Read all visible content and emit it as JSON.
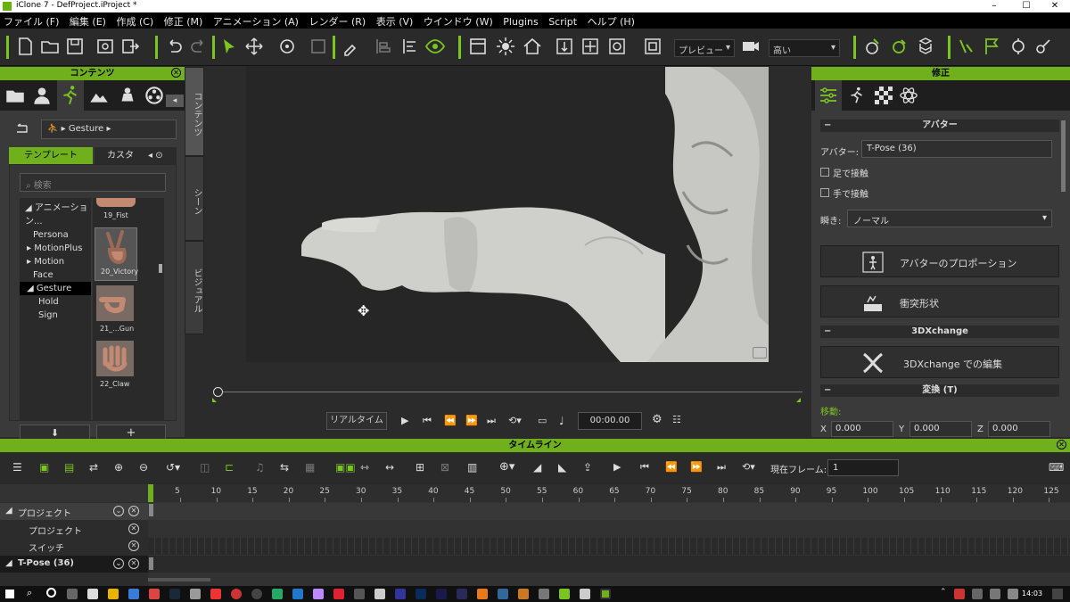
{
  "window": {
    "title": "iClone 7 - DefProject.iProject *",
    "minimize": "–",
    "maximize": "☐",
    "close": "✕"
  },
  "menu": [
    "ファイル (F)",
    "編集 (E)",
    "作成 (C)",
    "修正 (M)",
    "アニメーション (A)",
    "レンダー (R)",
    "表示 (V)",
    "ウインドウ (W)",
    "Plugins",
    "Script",
    "ヘルプ (H)"
  ],
  "toolbar": {
    "preview_label": "プレビュー",
    "quality_label": "高い"
  },
  "content_panel": {
    "title": "コンテンツ",
    "breadcrumb": "Gesture",
    "tabs": {
      "template": "テンプレート",
      "custom": "カスタ"
    },
    "search_placeholder": "検索",
    "tree": [
      {
        "label": "アニメーション..."
      },
      {
        "label": "Persona"
      },
      {
        "label": "MotionPlus"
      },
      {
        "label": "Motion"
      },
      {
        "label": "Face"
      },
      {
        "label": "Gesture"
      },
      {
        "label": "Hold"
      },
      {
        "label": "Sign"
      }
    ],
    "thumbs": [
      {
        "label": "19_Fist"
      },
      {
        "label": "20_Victory"
      },
      {
        "label": "21_...Gun"
      },
      {
        "label": "22_Claw"
      }
    ],
    "download_label": "⬇",
    "add_label": "+"
  },
  "side_tabs": [
    "コンテンツ",
    "シーン",
    "ビジュアル"
  ],
  "playback": {
    "realtime_label": "リアルタイム",
    "time": "00:00.00"
  },
  "modify_panel": {
    "title": "修正",
    "avatar_section": "アバター",
    "avatar_label": "アバター:",
    "avatar_value": "T-Pose (36)",
    "foot_contact": "足で接触",
    "hand_contact": "手で接触",
    "blink_label": "瞬き:",
    "blink_value": "ノーマル",
    "proportion_button": "アバターのプロポーション",
    "collision_button": "衝突形状",
    "exchange_section": "3DXchange",
    "exchange_button": "3DXchange での編集",
    "transform_section": "変換 (T)",
    "move_label": "移動:",
    "x_label": "X",
    "x_value": "0.000",
    "y_label": "Y",
    "y_value": "0.000",
    "z_label": "Z",
    "z_value": "0.000"
  },
  "timeline": {
    "title": "タイムライン",
    "current_frame_label": "現在フレーム:",
    "current_frame": "1",
    "ruler": [
      "5",
      "10",
      "15",
      "20",
      "25",
      "30",
      "35",
      "40",
      "45",
      "50",
      "55",
      "60",
      "65",
      "70",
      "75",
      "80",
      "85",
      "90",
      "95",
      "100",
      "105",
      "110",
      "115",
      "120",
      "125"
    ],
    "tracks": [
      {
        "label": "プロジェクト"
      },
      {
        "label": "プロジェクト"
      },
      {
        "label": "スイッチ"
      },
      {
        "label": "T-Pose (36)"
      }
    ]
  },
  "taskbar": {
    "time": "14:03"
  },
  "colors": {
    "accent": "#6fb01c",
    "panel": "#3a3a3a",
    "dark": "#1e1e1e"
  }
}
